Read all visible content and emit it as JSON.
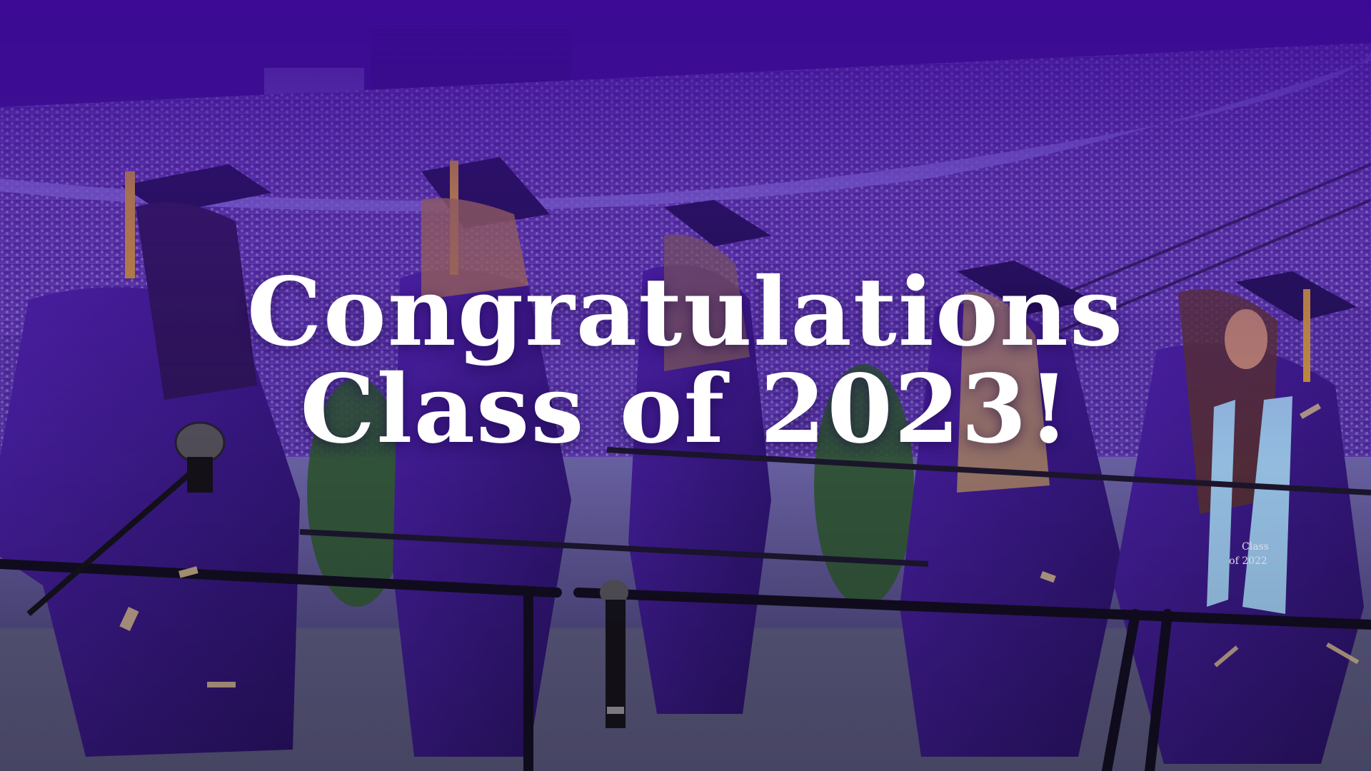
{
  "headline": {
    "line1": "Congratulations",
    "line2": "Class of 2023!"
  },
  "stole_text": {
    "line1": "Class",
    "line2": "of 2022"
  },
  "colors": {
    "overlay_purple": "#3c0a96",
    "gown_purple": "#3a1a8a",
    "tassel_gold": "#d9a030",
    "stole_light_blue": "#9fd0ee",
    "headline_white": "#ffffff"
  }
}
